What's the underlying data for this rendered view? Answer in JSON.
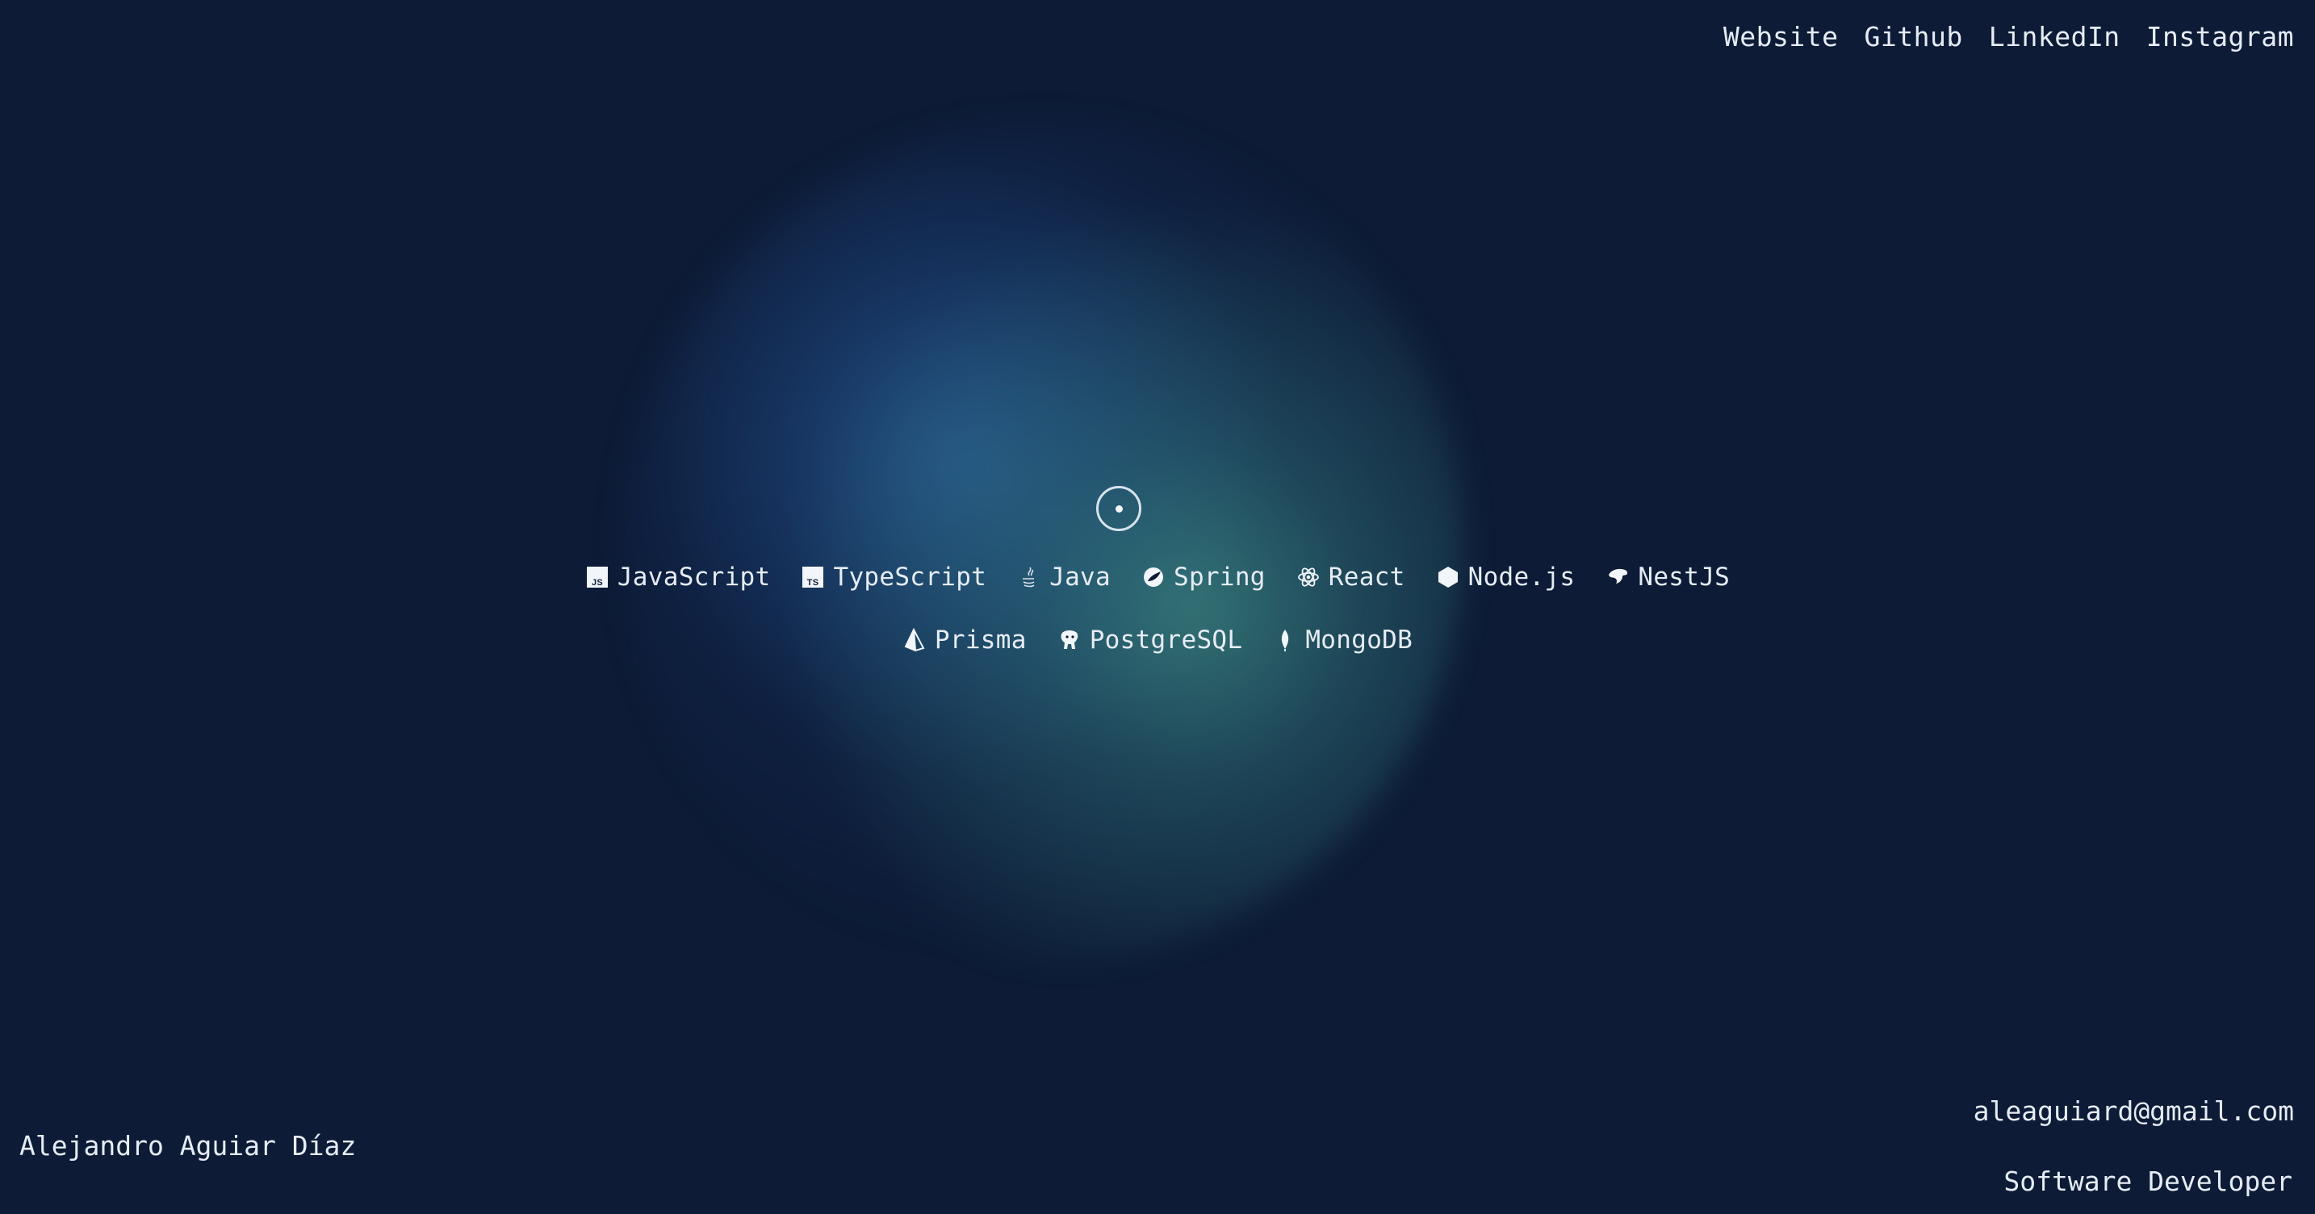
{
  "nav": {
    "links": [
      {
        "label": "Website"
      },
      {
        "label": "Github"
      },
      {
        "label": "LinkedIn"
      },
      {
        "label": "Instagram"
      }
    ]
  },
  "skills": {
    "row1": [
      {
        "label": "JavaScript",
        "icon": "javascript-icon"
      },
      {
        "label": "TypeScript",
        "icon": "typescript-icon"
      },
      {
        "label": "Java",
        "icon": "java-icon"
      },
      {
        "label": "Spring",
        "icon": "spring-icon"
      },
      {
        "label": "React",
        "icon": "react-icon"
      },
      {
        "label": "Node.js",
        "icon": "nodejs-icon"
      },
      {
        "label": "NestJS",
        "icon": "nestjs-icon"
      }
    ],
    "row2": [
      {
        "label": "Prisma",
        "icon": "prisma-icon"
      },
      {
        "label": "PostgreSQL",
        "icon": "postgresql-icon"
      },
      {
        "label": "MongoDB",
        "icon": "mongodb-icon"
      }
    ]
  },
  "footer": {
    "name": "Alejandro Aguiar Díaz",
    "email": "aleaguiard@gmail.com",
    "role": "Software Developer"
  },
  "colors": {
    "background": "#0d1b36",
    "glow_blue": "#285c96",
    "glow_teal": "#3e8c84",
    "text": "#e6ecf5"
  }
}
